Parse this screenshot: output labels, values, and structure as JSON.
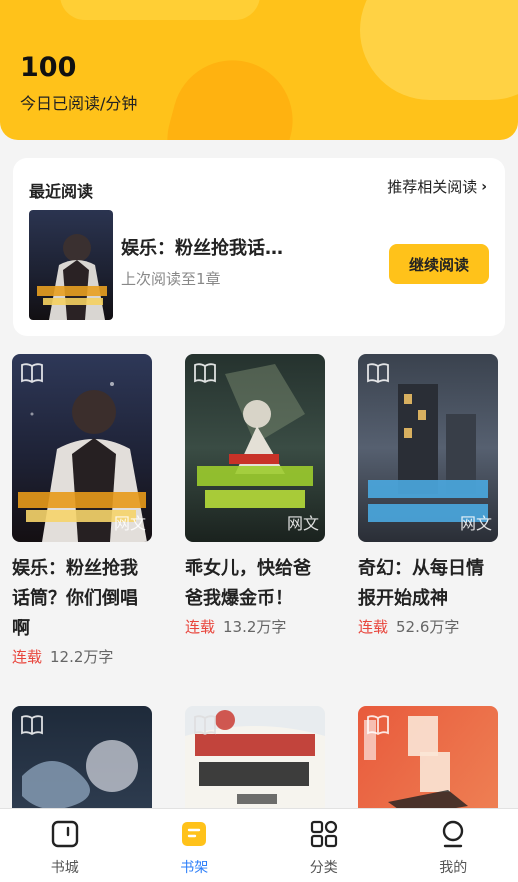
{
  "header": {
    "minutes": "100",
    "minutes_label": "今日已阅读/分钟"
  },
  "recent": {
    "title": "最近阅读",
    "recommend_label": "推荐相关阅读",
    "book_title": "娱乐：粉丝抢我话…",
    "progress": "上次阅读至1章",
    "continue_label": "继续阅读"
  },
  "cover_tag": "网文",
  "books": [
    {
      "title": "娱乐：粉丝抢我话筒？你们倒唱啊",
      "status": "连载",
      "words": "12.2万字"
    },
    {
      "title": "乖女儿，快给爸爸我爆金币！",
      "status": "连载",
      "words": "13.2万字"
    },
    {
      "title": "奇幻：从每日情报开始成神",
      "status": "连载",
      "words": "52.6万字"
    }
  ],
  "tabs": [
    {
      "label": "书城",
      "icon": "bookstore-icon"
    },
    {
      "label": "书架",
      "icon": "bookshelf-icon"
    },
    {
      "label": "分类",
      "icon": "category-icon"
    },
    {
      "label": "我的",
      "icon": "profile-icon"
    }
  ],
  "colors": {
    "accent": "#ffc21a",
    "active_tab": "#2d7ff9",
    "status": "#e8453c"
  }
}
